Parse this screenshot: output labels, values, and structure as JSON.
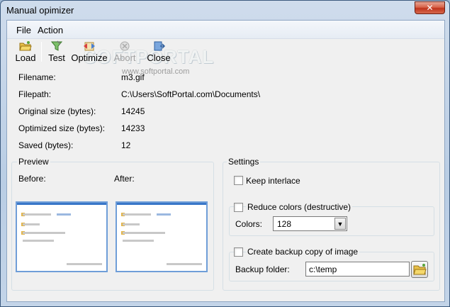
{
  "window": {
    "title": "Manual opimizer",
    "close_glyph": "✕"
  },
  "menu": {
    "items": [
      {
        "label": "File"
      },
      {
        "label": "Action"
      }
    ]
  },
  "toolbar": {
    "load": {
      "label": "Load",
      "icon": "folder-open-icon"
    },
    "test": {
      "label": "Test",
      "icon": "test-funnel-icon"
    },
    "optimize": {
      "label": "Optimize",
      "icon": "optimize-icon"
    },
    "abort": {
      "label": "Abort",
      "icon": "abort-icon",
      "disabled": true
    },
    "close": {
      "label": "Close",
      "icon": "close-icon"
    }
  },
  "watermark": {
    "text": "SOFTPORTAL",
    "sub": "www.softportal.com"
  },
  "info": {
    "filename_label": "Filename:",
    "filename": "m3.gif",
    "filepath_label": "Filepath:",
    "filepath": "C:\\Users\\SoftPortal.com\\Documents\\",
    "original_label": "Original size (bytes):",
    "original": "14245",
    "optimized_label": "Optimized size (bytes):",
    "optimized": "14233",
    "saved_label": "Saved (bytes):",
    "saved": "12"
  },
  "preview": {
    "title": "Preview",
    "before_label": "Before:",
    "after_label": "After:"
  },
  "settings": {
    "title": "Settings",
    "keep_interlace": {
      "label": "Keep interlace",
      "checked": false
    },
    "reduce_colors": {
      "label": "Reduce colors (destructive)",
      "checked": false
    },
    "colors_label": "Colors:",
    "colors_value": "128",
    "backup": {
      "label": "Create backup copy of image",
      "checked": false
    },
    "backup_folder_label": "Backup folder:",
    "backup_folder_value": "c:\\temp"
  },
  "colors": {
    "accent": "#3a77c8",
    "title_close": "#c0341c"
  }
}
